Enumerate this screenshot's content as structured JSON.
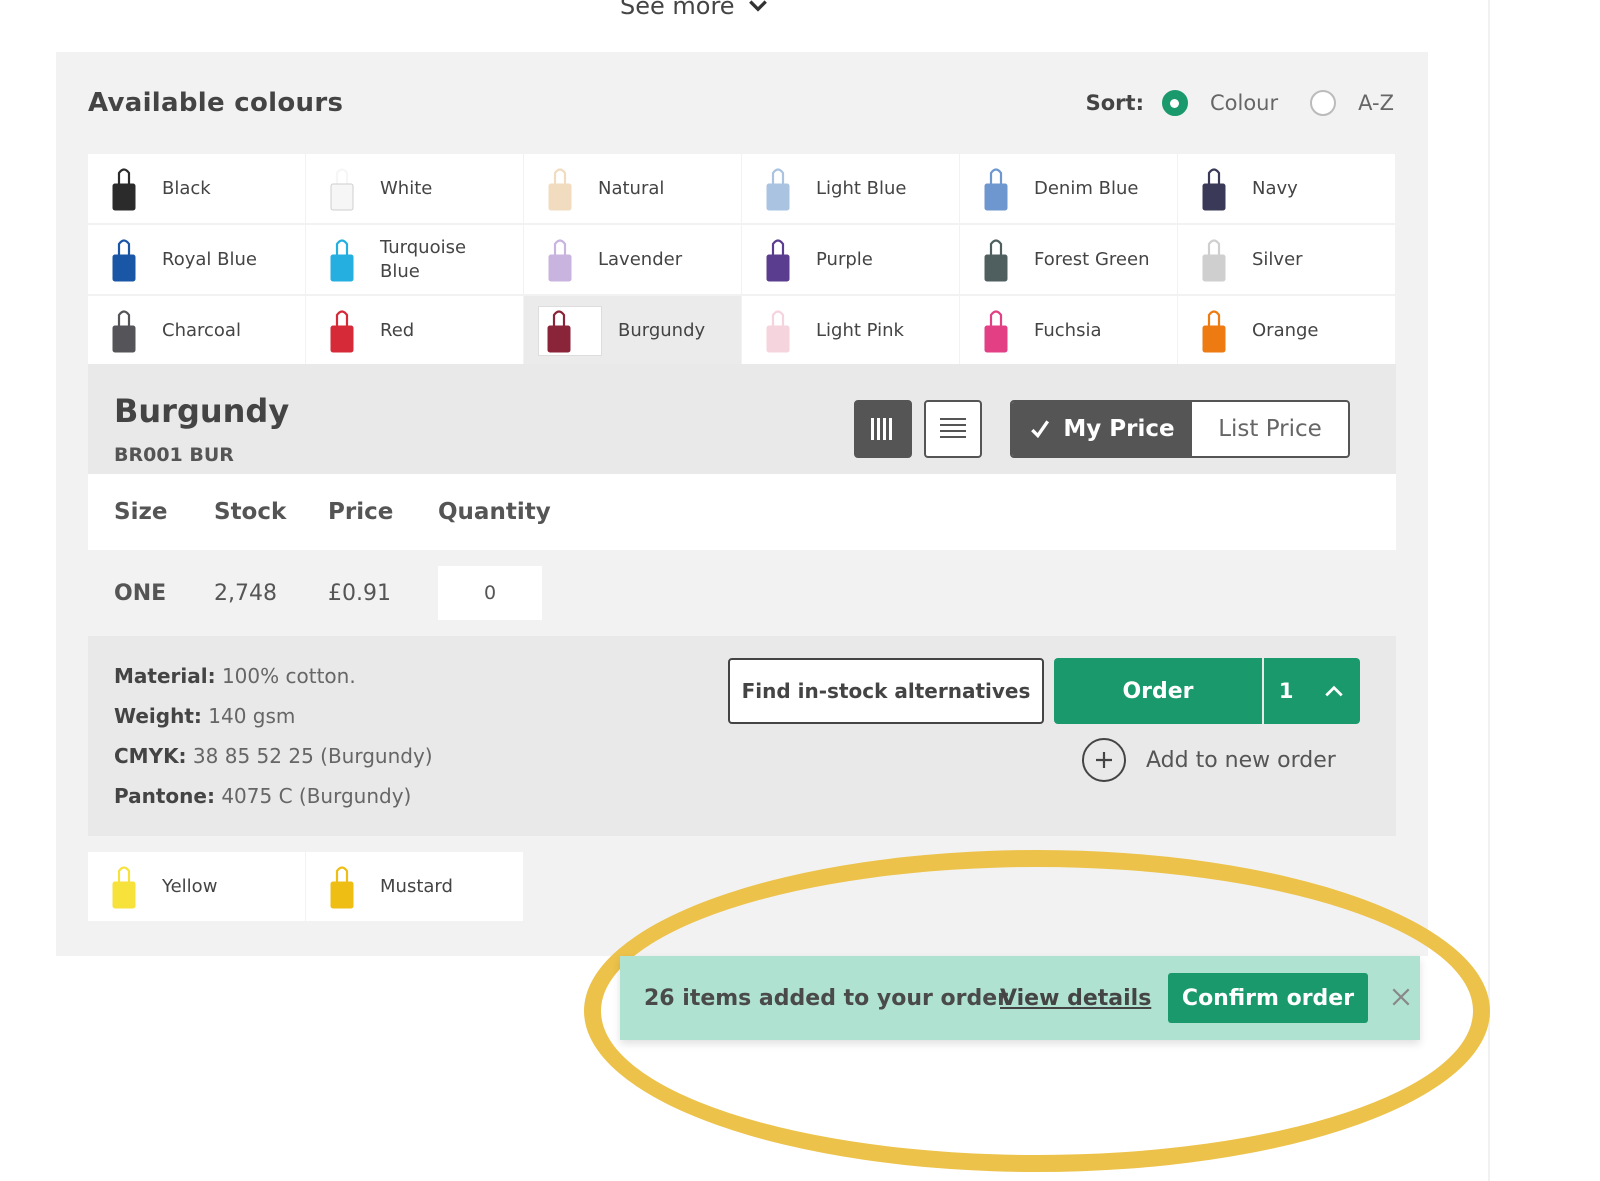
{
  "header": {
    "see_more_label": "See more"
  },
  "colours_panel": {
    "title": "Available colours",
    "sort": {
      "label": "Sort:",
      "options": [
        "Colour",
        "A-Z"
      ],
      "selected": "Colour"
    },
    "swatches": [
      {
        "name": "Black",
        "color": "#2b2b2b"
      },
      {
        "name": "White",
        "color": "#f6f6f6"
      },
      {
        "name": "Natural",
        "color": "#f1dcc0"
      },
      {
        "name": "Light Blue",
        "color": "#a9c3e0"
      },
      {
        "name": "Denim Blue",
        "color": "#6f97cf"
      },
      {
        "name": "Navy",
        "color": "#3a3957"
      },
      {
        "name": "Royal Blue",
        "color": "#1a56a6"
      },
      {
        "name": "Turquoise Blue",
        "color": "#25aee0"
      },
      {
        "name": "Lavender",
        "color": "#c8b4de"
      },
      {
        "name": "Purple",
        "color": "#5a3d8f"
      },
      {
        "name": "Forest Green",
        "color": "#4f5f5f"
      },
      {
        "name": "Silver",
        "color": "#cfcfcf"
      },
      {
        "name": "Charcoal",
        "color": "#555559"
      },
      {
        "name": "Red",
        "color": "#d62a38"
      },
      {
        "name": "Burgundy",
        "color": "#8a2438"
      },
      {
        "name": "Light Pink",
        "color": "#f6d4de"
      },
      {
        "name": "Fuchsia",
        "color": "#e23f84"
      },
      {
        "name": "Orange",
        "color": "#ee7a12"
      }
    ],
    "selected_swatch": "Burgundy",
    "extra_swatches": [
      {
        "name": "Yellow",
        "color": "#f6e23a"
      },
      {
        "name": "Mustard",
        "color": "#efbe14"
      }
    ]
  },
  "detail": {
    "title": "Burgundy",
    "code": "BR001 BUR",
    "price_toggle": {
      "active": "My Price",
      "inactive": "List Price"
    },
    "table": {
      "headers": [
        "Size",
        "Stock",
        "Price",
        "Quantity"
      ],
      "row": {
        "size": "ONE",
        "stock": "2,748",
        "price": "£0.91",
        "quantity": "0"
      }
    },
    "specs": [
      {
        "label": "Material:",
        "value": "100% cotton."
      },
      {
        "label": "Weight:",
        "value": "140 gsm"
      },
      {
        "label": "CMYK:",
        "value": "38 85 52 25 (Burgundy)"
      },
      {
        "label": "Pantone:",
        "value": "4075 C (Burgundy)"
      }
    ],
    "alternatives_button": "Find in-stock alternatives",
    "order_button": "Order",
    "order_count": "1",
    "add_new_order": "Add to new order"
  },
  "toast": {
    "message": "26 items added to your order.",
    "link": "View details",
    "confirm_button": "Confirm order"
  },
  "colors": {
    "accent": "#1a9a6c",
    "toast_bg": "#b0e2d1",
    "highlight_ring": "#ecc24a"
  }
}
